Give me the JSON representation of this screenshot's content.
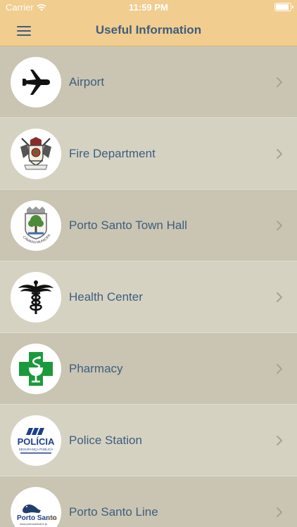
{
  "status_bar": {
    "carrier": "Carrier",
    "time": "11:59 PM",
    "battery_level": 0.9
  },
  "header": {
    "title": "Useful Information",
    "background_color": "#f1cd8f",
    "text_color": "#3f5d7e"
  },
  "list": {
    "items": [
      {
        "label": "Airport",
        "icon": "airplane-icon"
      },
      {
        "label": "Fire Department",
        "icon": "fire-department-crest-icon"
      },
      {
        "label": "Porto Santo Town Hall",
        "icon": "town-hall-crest-icon"
      },
      {
        "label": "Health Center",
        "icon": "caduceus-icon"
      },
      {
        "label": "Pharmacy",
        "icon": "pharmacy-cross-icon"
      },
      {
        "label": "Police Station",
        "icon": "police-logo-icon"
      },
      {
        "label": "Porto Santo Line",
        "icon": "porto-santo-line-logo-icon"
      }
    ]
  },
  "logos": {
    "town_hall_crest_text": "CÂMARA MUNICIPAL DO PORTO SANTO",
    "police_title": "POLÍCIA",
    "police_subtitle": "SEGURANÇA PÚBLICA",
    "porto_santo_line_brand": "Porto Santo",
    "porto_santo_line_suffix": "Line",
    "porto_santo_line_url": "www.portosantoline.pt"
  },
  "colors": {
    "row_dark": "#c9c5b2",
    "row_light": "#d6d2c2",
    "pharmacy_green": "#1a9a3c",
    "police_blue": "#1f3f8c"
  }
}
